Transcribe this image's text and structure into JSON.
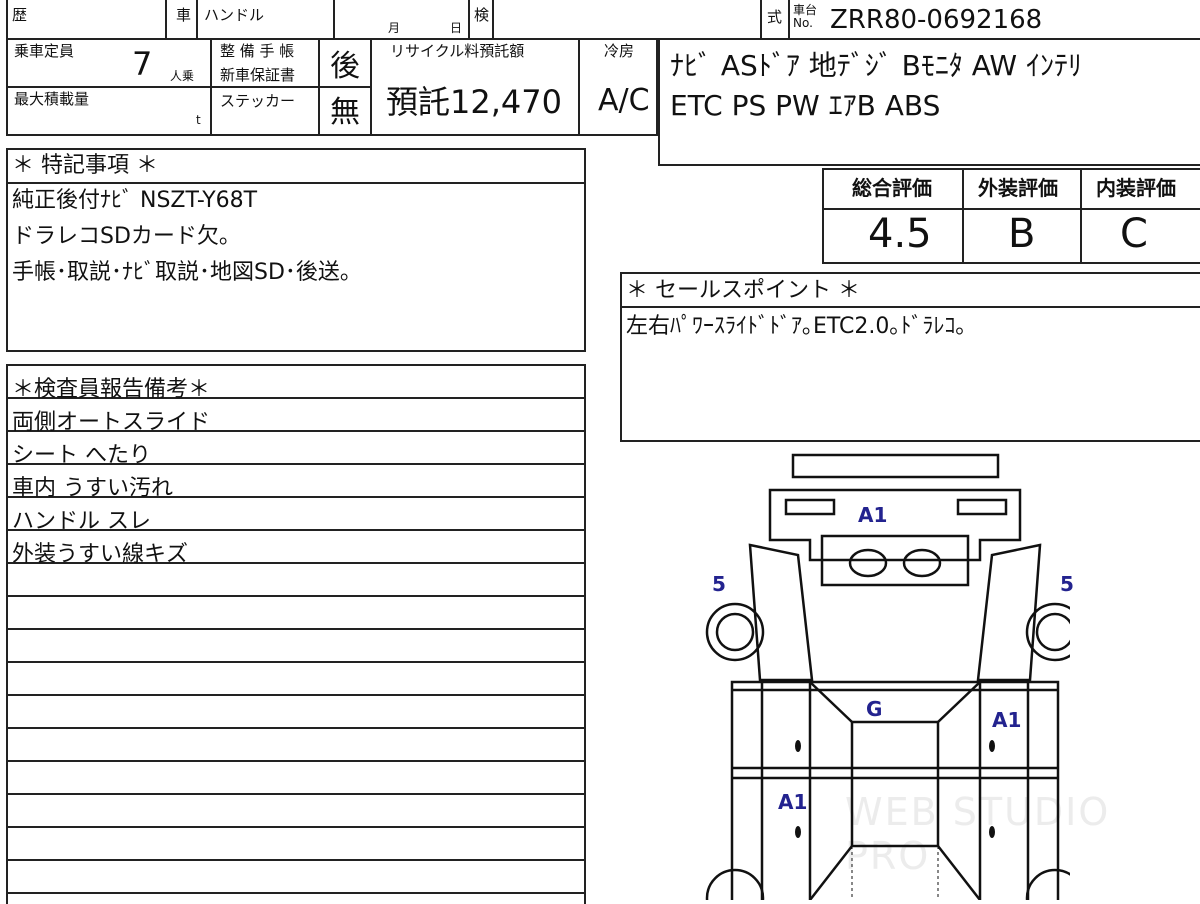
{
  "header": {
    "reki": "歴",
    "sha": "車",
    "handle": "ハンドル",
    "month": "月",
    "day": "日",
    "ken": "検",
    "shiki": "式",
    "shadai_no": "車台 No.",
    "chassis": "ZRR80-0692168"
  },
  "specs": {
    "capacity_label": "乗車定員",
    "capacity_value": "7",
    "capacity_unit": "人乗",
    "maint_book_label": "整 備 手 帳",
    "warranty_label": "新車保証書",
    "maint_value": "後",
    "sticker_label": "ステッカー",
    "sticker_value": "無",
    "max_load_label": "最大積載量",
    "max_load_unit": "t",
    "recycle_label": "リサイクル料預託額",
    "recycle_value": "預託12,470",
    "aircon_label": "冷房",
    "aircon_value": "A/C"
  },
  "equipment": {
    "line1": "ﾅﾋﾞ ASﾄﾞｱ 地ﾃﾞｼﾞ Bﾓﾆﾀ AW ｲﾝﾃﾘ",
    "line2": "ETC PS PW ｴｱB ABS"
  },
  "ratings": {
    "overall_label": "総合評価",
    "overall_value": "4.5",
    "exterior_label": "外装評価",
    "exterior_value": "B",
    "interior_label": "内装評価",
    "interior_value": "C"
  },
  "special": {
    "title": "＊ 特記事項 ＊",
    "lines": [
      "純正後付ﾅﾋﾞ NSZT-Y68T",
      "ドラレコSDカード欠。",
      "手帳･取説･ﾅﾋﾞ取説･地図SD･後送。"
    ]
  },
  "sales": {
    "title": "＊ セールスポイント ＊",
    "text": "左右ﾊﾟﾜｰｽﾗｲﾄﾞﾄﾞｱ｡ETC2.0｡ﾄﾞﾗﾚｺ｡"
  },
  "inspector": {
    "title": "＊検査員報告備考＊",
    "rows": [
      "両側オートスライド",
      "シート へたり",
      "車内 うすい汚れ",
      "ハンドル スレ",
      "外装うすい線キズ"
    ]
  },
  "diagram_marks": {
    "front_a1": "A1",
    "left_5": "5",
    "right_5": "5",
    "glass_g": "G",
    "right_door_a1": "A1",
    "left_door_a1": "A1"
  },
  "watermark": "WEB STUDIO PRO"
}
